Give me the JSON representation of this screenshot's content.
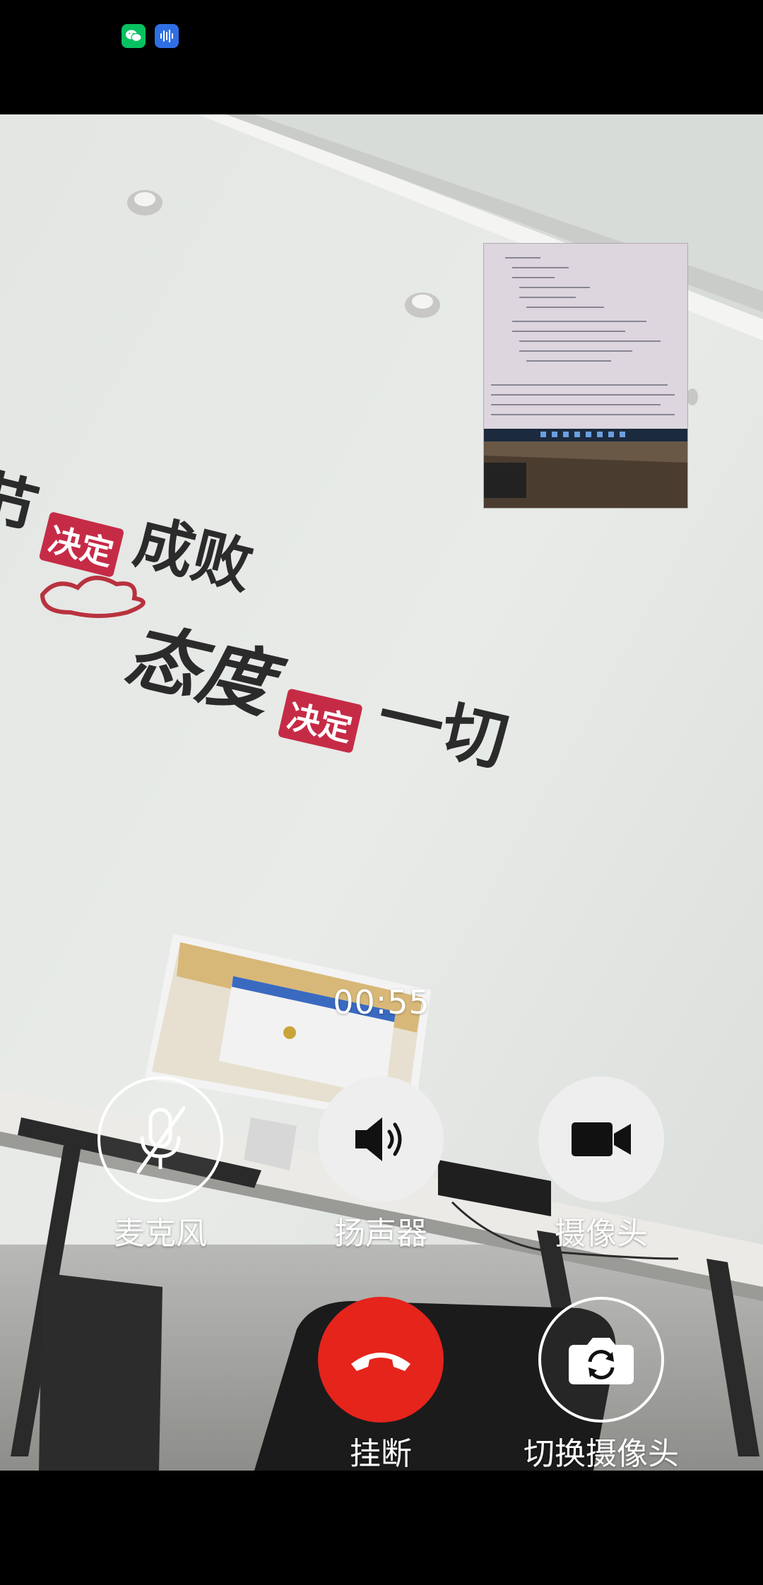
{
  "status_bar": {
    "apps": [
      {
        "icon": "wechat-icon",
        "color": "#07c160"
      },
      {
        "icon": "voice-recorder-icon",
        "color": "#2f6fe4"
      }
    ]
  },
  "call": {
    "duration": "00:55"
  },
  "wall_slogan": {
    "line1_prefix": "节",
    "line1_stamp": "决定",
    "line1_end": "成败",
    "line2_start": "态度",
    "line2_stamp": "决定",
    "line2_end": "一切"
  },
  "controls": {
    "microphone": {
      "label": "麦克风",
      "icon": "microphone-muted-icon",
      "state": "muted"
    },
    "speaker": {
      "label": "扬声器",
      "icon": "speaker-icon",
      "state": "on"
    },
    "camera": {
      "label": "摄像头",
      "icon": "video-camera-icon",
      "state": "on"
    },
    "hangup": {
      "label": "挂断",
      "icon": "hang-up-icon",
      "color": "#e5241c"
    },
    "switch_camera": {
      "label": "切换摄像头",
      "icon": "switch-camera-icon"
    }
  }
}
